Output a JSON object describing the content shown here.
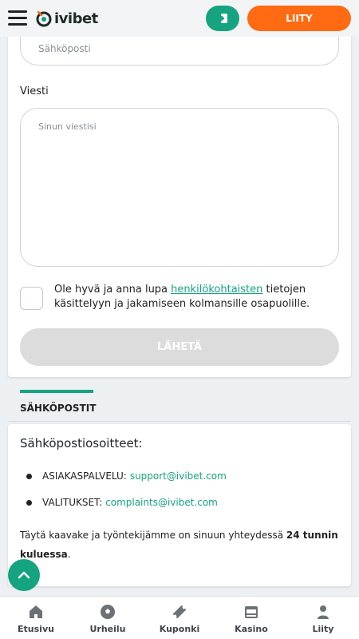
{
  "header": {
    "logo_text": "ivibet",
    "join_label": "LIITY"
  },
  "form": {
    "email_placeholder": "Sähköposti",
    "message_label": "Viesti",
    "message_placeholder": "Sinun viestisi",
    "consent_before": "Ole hyvä ja anna lupa ",
    "consent_link": "henkilökohtaisten",
    "consent_after": " tietojen käsittelyyn ja jakamiseen kolmansille osapuolille.",
    "submit_label": "LÄHETÄ"
  },
  "section": {
    "title": "SÄHKÖPOSTIT"
  },
  "emails": {
    "heading": "Sähköpostiosoitteet:",
    "items": [
      {
        "label": "ASIAKASPALVELU:",
        "address": "support@ivibet.com"
      },
      {
        "label": "VALITUKSET:",
        "address": "complaints@ivibet.com"
      }
    ],
    "note_before": "Täytä kaavake ja työntekijämme on sinuun yhteydessä ",
    "note_bold": "24 tunnin kuluessa",
    "note_after": "."
  },
  "nav": {
    "items": [
      {
        "label": "Etusivu",
        "icon": "home-icon"
      },
      {
        "label": "Urheilu",
        "icon": "soccer-ball-icon"
      },
      {
        "label": "Kuponki",
        "icon": "ticket-icon"
      },
      {
        "label": "Kasino",
        "icon": "slot-machine-icon"
      },
      {
        "label": "Liity",
        "icon": "user-icon"
      }
    ]
  },
  "colors": {
    "accent_green": "#16a37f",
    "accent_orange": "#ff6a13"
  }
}
